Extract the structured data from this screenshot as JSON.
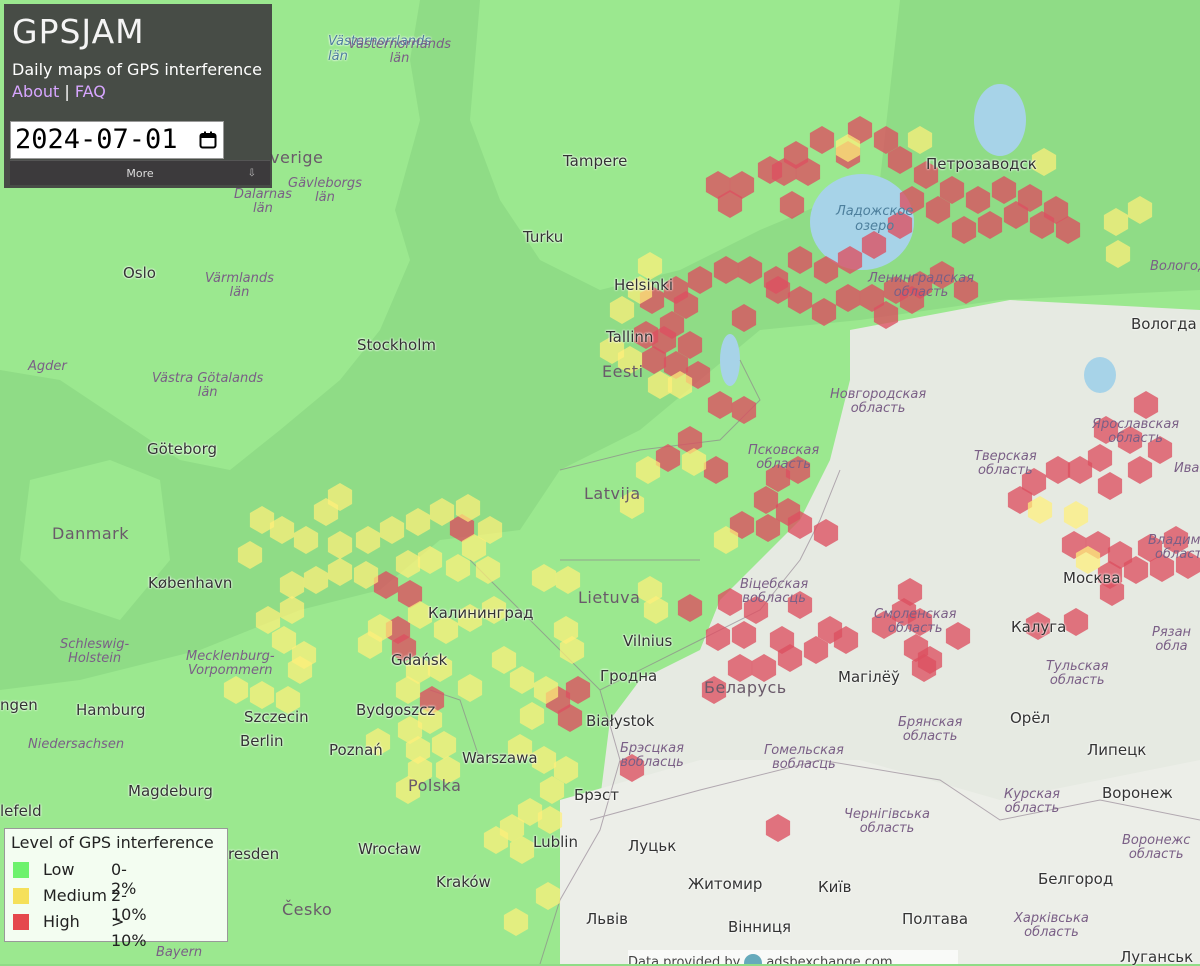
{
  "app": {
    "title": "GPSJAM",
    "tagline": "Daily maps of GPS interference",
    "links": {
      "about": "About",
      "separator": "|",
      "faq": "FAQ"
    },
    "date": "2024-07-01",
    "more_label": "More",
    "more_handle": "⇩",
    "calendar_icon": "calendar-icon"
  },
  "legend": {
    "title": "Level of GPS interference",
    "levels": [
      {
        "name": "Low",
        "range": "0-2%",
        "color": "#6df26d"
      },
      {
        "name": "Medium",
        "range": "2-10%",
        "color": "#f5e05a"
      },
      {
        "name": "High",
        "range": "> 10%",
        "color": "#e5484d"
      }
    ]
  },
  "credit": {
    "text": "Data provided by",
    "source": "adsbexchange.com"
  },
  "colors": {
    "low": "#86ea7c",
    "medium": "#fff07a",
    "high": "#dc5060",
    "sea": "#8fdc86",
    "land": "#9fe896",
    "lake": "#a7d3e8",
    "russia_land": "#e6eae2"
  },
  "places": {
    "vasternorrland": "Västernorrlands\nlän",
    "tampere": "Tampere",
    "petrozavodsk": "Петрозаводск",
    "sverige": "verige",
    "gavleborg": "Gävleborgs\nlän",
    "dalarnas": "Dalarnas\nlän",
    "turku": "Turku",
    "ladoga": "Ладожское\nозеро",
    "oslo": "Oslo",
    "varmlands": "Värmlands\nlän",
    "helsinki": "Helsinki",
    "leningrad_obl": "Ленинградская\nобласть",
    "vologda_obl": "Вологод",
    "vologda": "Вологда",
    "stockholm": "Stockholm",
    "tallinn": "Tallinn",
    "eesti": "Eesti",
    "agder": "Agder",
    "vastra_gotaland": "Västra Götalands\nlän",
    "novgorod_obl": "Новгородская\nобласть",
    "goteborg": "Göteborg",
    "yaroslavl_obl": "Ярославская\nобласть",
    "pskov_obl": "Псковская\nобласть",
    "tver_obl": "Тверская\nобласть",
    "ivan": "Иван",
    "latvija": "Latvija",
    "danmark": "Danmark",
    "vladimir_obl": "Владими\nобласт",
    "kobenhavn": "København",
    "moskva": "Москва",
    "lietuva": "Lietuva",
    "vitebsk": "Віцебская\nвобласць",
    "kaliningrad": "Калининград",
    "smolensk": "Смоленская\nобласть",
    "kaluga": "Калуга",
    "ryazan": "Рязан\nобла",
    "schleswig": "Schleswig-\nHolstein",
    "mecklenburg": "Mecklenburg-\nVorpommern",
    "gdansk": "Gdańsk",
    "vilnius": "Vilnius",
    "tula_obl": "Тульская\nобласть",
    "hrodna": "Гродна",
    "belarus": "Беларусь",
    "mahilyow": "Магілёў",
    "hen": "ngen",
    "hamburg": "Hamburg",
    "szczecin": "Szczecin",
    "bydgoszcz": "Bydgoszcz",
    "bialystok": "Białystok",
    "oryol": "Орёл",
    "bryansk_obl": "Брянская\nобласть",
    "niedersachsen": "Niedersachsen",
    "berlin": "Berlin",
    "poznan": "Poznań",
    "lipetsk": "Липецк",
    "warszawa": "Warszawa",
    "brest_obl": "Брэсцкая\nвобласць",
    "homel_obl": "Гомельская\nвобласць",
    "magdeburg": "Magdeburg",
    "polska": "Polska",
    "voronezh": "Воронеж",
    "brest": "Брэст",
    "elefeld": "lefeld",
    "kursk_obl": "Курская\nобласть",
    "chernihiv_obl": "Чернігівська\nобласть",
    "voronezh_obl": "Воронежс\nобласть",
    "resden": "resden",
    "wroclaw": "Wrocław",
    "lublin": "Lublin",
    "lutsk": "Луцьк",
    "zhytomyr": "Житомир",
    "kyiv": "Київ",
    "belgorod": "Белгород",
    "krakow": "Kraków",
    "cesko": "Česko",
    "lviv": "Львів",
    "vinnytsia": "Вінниця",
    "poltava": "Полтава",
    "kharkiv_obl": "Харківська\nобласть",
    "bayern": "Bayern",
    "luhansk": "Луганськ"
  }
}
